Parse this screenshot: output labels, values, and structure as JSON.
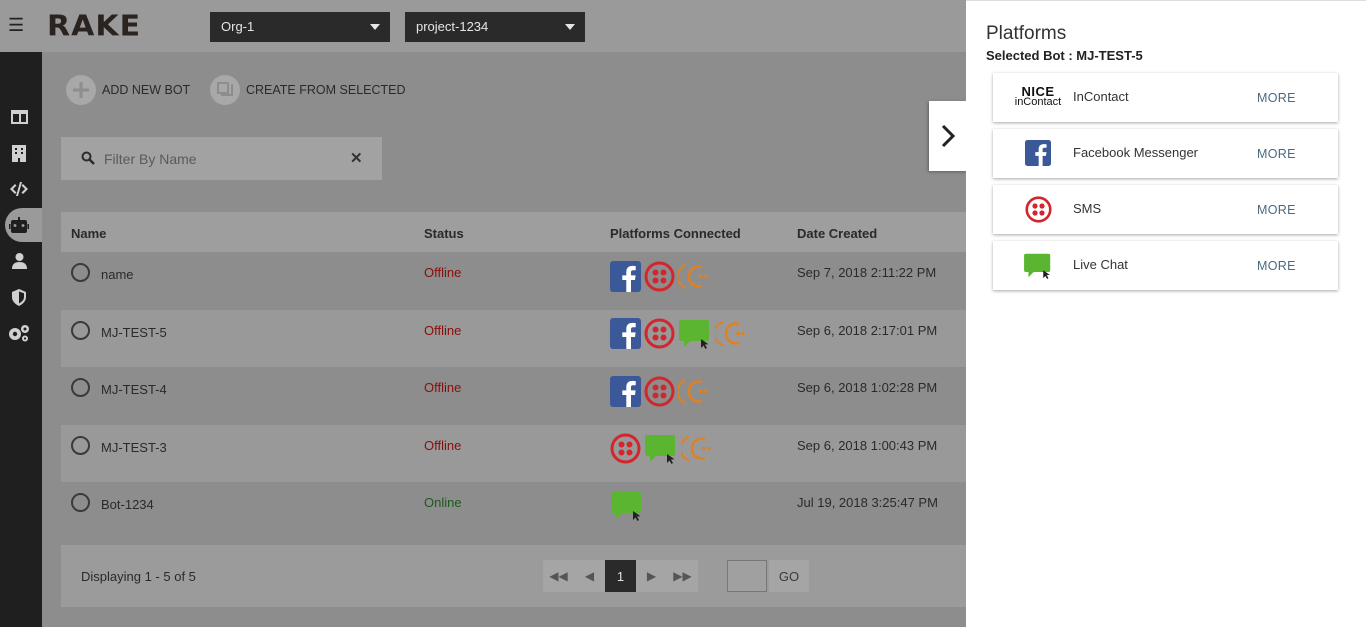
{
  "header": {
    "logo": "RAKE",
    "org_select": "Org-1",
    "project_select": "project-1234"
  },
  "actions": {
    "add_new_bot": "ADD NEW BOT",
    "create_from_selected": "CREATE FROM SELECTED"
  },
  "filter": {
    "placeholder": "Filter By Name"
  },
  "table": {
    "columns": [
      "Name",
      "Status",
      "Platforms Connected",
      "Date Created"
    ],
    "rows": [
      {
        "name": "name",
        "status": "Offline",
        "platforms": [
          "facebook",
          "sms",
          "incontact"
        ],
        "date": "Sep 7, 2018 2:11:22 PM"
      },
      {
        "name": "MJ-TEST-5",
        "status": "Offline",
        "platforms": [
          "facebook",
          "sms",
          "livechat",
          "incontact"
        ],
        "date": "Sep 6, 2018 2:17:01 PM"
      },
      {
        "name": "MJ-TEST-4",
        "status": "Offline",
        "platforms": [
          "facebook",
          "sms",
          "incontact"
        ],
        "date": "Sep 6, 2018 1:02:28 PM"
      },
      {
        "name": "MJ-TEST-3",
        "status": "Offline",
        "platforms": [
          "sms",
          "livechat",
          "incontact"
        ],
        "date": "Sep 6, 2018 1:00:43 PM"
      },
      {
        "name": "Bot-1234",
        "status": "Online",
        "platforms": [
          "livechat"
        ],
        "date": "Jul 19, 2018 3:25:47 PM"
      }
    ]
  },
  "footer": {
    "displaying": "Displaying 1 - 5 of 5",
    "current_page": "1",
    "go": "GO"
  },
  "panel": {
    "title": "Platforms",
    "selected_bot": "Selected Bot : MJ-TEST-5",
    "platforms": [
      {
        "name": "InContact",
        "more": "MORE",
        "logo_top": "NICE",
        "logo_bottom": "inContact"
      },
      {
        "name": "Facebook Messenger",
        "more": "MORE"
      },
      {
        "name": "SMS",
        "more": "MORE"
      },
      {
        "name": "Live Chat",
        "more": "MORE"
      }
    ]
  },
  "colors": {
    "facebook": "#3b5998",
    "sms": "#d2262e",
    "livechat": "#5cb531",
    "incontact": "#e0801f"
  }
}
